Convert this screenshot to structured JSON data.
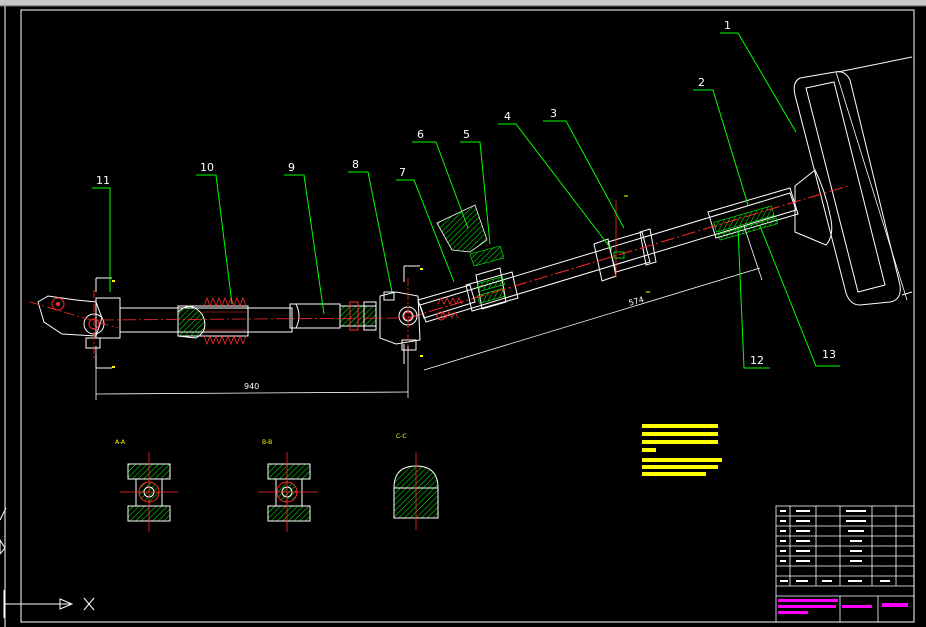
{
  "colors": {
    "background": "#000000",
    "outline": "#ffffff",
    "leader": "#00ff00",
    "center_line": "#ff2a2a",
    "hatch": "#00ff00",
    "note_block": "#ffff00",
    "title_block_magenta": "#ff00ff"
  },
  "callouts": [
    "1",
    "2",
    "3",
    "4",
    "5",
    "6",
    "7",
    "8",
    "9",
    "10",
    "11",
    "12",
    "13"
  ],
  "dimensions": {
    "horizontal": "940",
    "oblique": "574"
  },
  "section_labels": [
    "A-A",
    "B-B",
    "C-C"
  ],
  "icons": [
    "ucs-axis-icon"
  ]
}
